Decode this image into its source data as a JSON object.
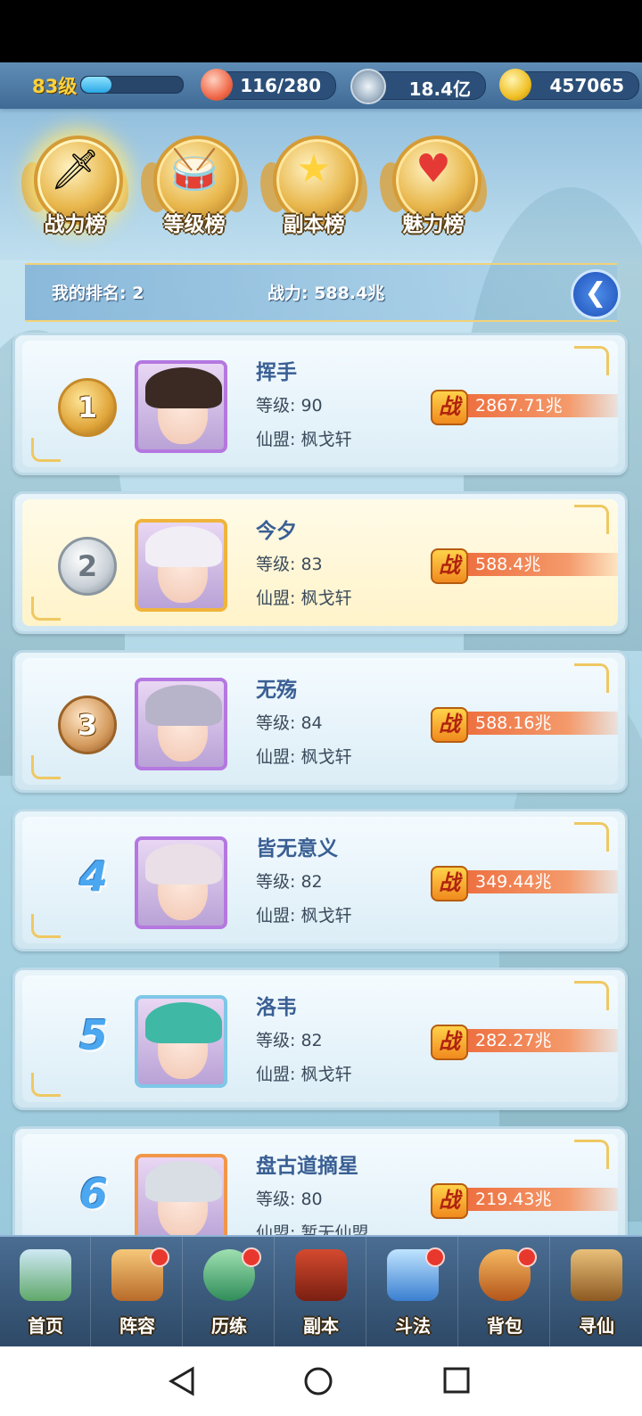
{
  "top": {
    "level": "83级",
    "exp_fraction": 0.3,
    "stamina": "116/280",
    "coins": "18.4亿",
    "gold": "457065",
    "stamina_icon": "peach-icon",
    "coins_icon": "copper-coin-icon",
    "gold_icon": "gold-ingot-icon"
  },
  "tabs": [
    {
      "label": "战力榜",
      "icon": "sword-emblem-icon",
      "active": true
    },
    {
      "label": "等级榜",
      "icon": "drum-emblem-icon",
      "active": false
    },
    {
      "label": "副本榜",
      "icon": "star-emblem-icon",
      "active": false
    },
    {
      "label": "魅力榜",
      "icon": "heart-emblem-icon",
      "active": false
    }
  ],
  "my_rank": {
    "rank_text": "我的排名: 2",
    "power_text": "战力: 588.4兆",
    "back_icon": "back-arrow-icon"
  },
  "rows": [
    {
      "rank": "1",
      "name": "挥手",
      "level": "等级: 90",
      "guild": "仙盟: 枫戈轩",
      "power": "2867.71兆"
    },
    {
      "rank": "2",
      "name": "今夕",
      "level": "等级: 83",
      "guild": "仙盟: 枫戈轩",
      "power": "588.4兆"
    },
    {
      "rank": "3",
      "name": "无殇",
      "level": "等级: 84",
      "guild": "仙盟: 枫戈轩",
      "power": "588.16兆"
    },
    {
      "rank": "4",
      "name": "皆无意义",
      "level": "等级: 82",
      "guild": "仙盟: 枫戈轩",
      "power": "349.44兆"
    },
    {
      "rank": "5",
      "name": "洛韦",
      "level": "等级: 82",
      "guild": "仙盟: 枫戈轩",
      "power": "282.27兆"
    },
    {
      "rank": "6",
      "name": "盘古道摘星",
      "level": "等级: 80",
      "guild": "仙盟: 暂无仙盟",
      "power": "219.43兆"
    }
  ],
  "power_badge": "战",
  "nav": [
    {
      "label": "首页",
      "icon": "home-island-icon",
      "badge": false
    },
    {
      "label": "阵容",
      "icon": "cards-icon",
      "badge": true
    },
    {
      "label": "历练",
      "icon": "gourd-icon",
      "badge": true
    },
    {
      "label": "副本",
      "icon": "gate-icon",
      "badge": false
    },
    {
      "label": "斗法",
      "icon": "arena-icon",
      "badge": true
    },
    {
      "label": "背包",
      "icon": "bag-icon",
      "badge": true
    },
    {
      "label": "寻仙",
      "icon": "scroll-icon",
      "badge": false
    }
  ],
  "colors": {
    "accent_gold": "#ffd23b",
    "power_bar": "#ed6a3a",
    "rank_blue": "#4aa7f0",
    "name_blue": "#3a5f94"
  }
}
